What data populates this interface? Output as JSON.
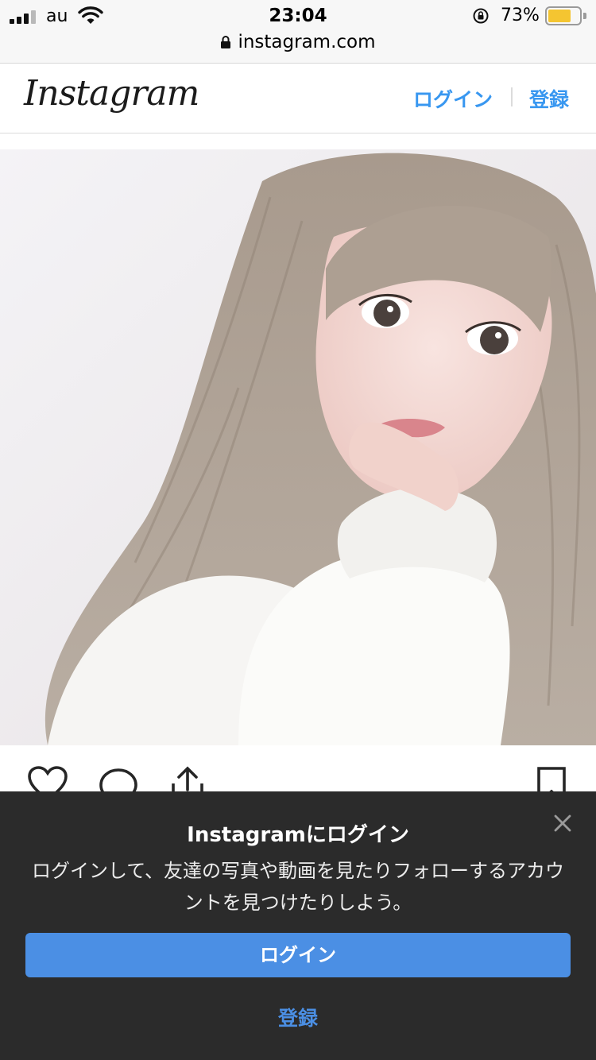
{
  "status_bar": {
    "carrier": "au",
    "time": "23:04",
    "battery_percent": "73%",
    "battery_level": 0.73,
    "icons": [
      "signal-icon",
      "wifi-icon",
      "rotation-lock-icon",
      "battery-icon"
    ]
  },
  "url_bar": {
    "domain": "instagram.com",
    "icon": "padlock-icon"
  },
  "header": {
    "logo": "Instagram",
    "login_label": "ログイン",
    "signup_label": "登録",
    "link_color": "#3897f0"
  },
  "post": {
    "actions": [
      "heart-icon",
      "comment-icon",
      "share-icon",
      "bookmark-icon"
    ]
  },
  "login_sheet": {
    "title": "Instagramにログイン",
    "description": "ログインして、友達の写真や動画を見たりフォローするアカウントを見つけたりしよう。",
    "login_button": "ログイン",
    "signup_link": "登録",
    "background_color": "#2b2b2b",
    "accent_color": "#4b8fe4",
    "close_icon": "close-icon"
  }
}
